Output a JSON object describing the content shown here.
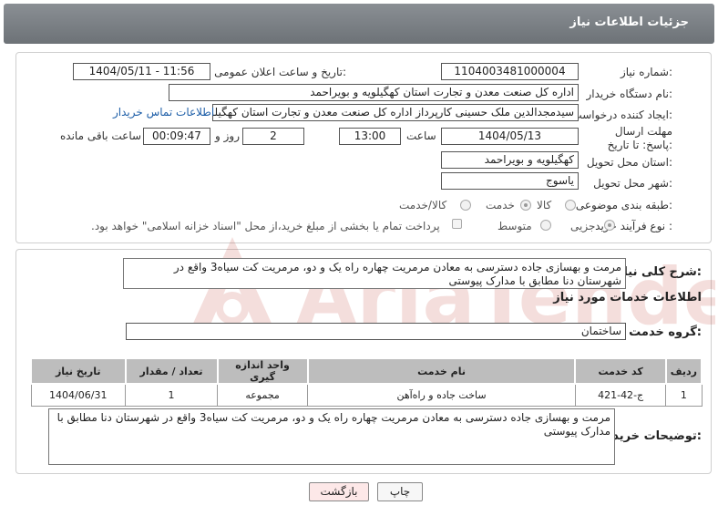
{
  "header": {
    "title": "جزئیات اطلاعات نیاز"
  },
  "form": {
    "need_number_label": "شماره نیاز:",
    "need_number": "1104003481000004",
    "announce_label": "تاریخ و ساعت اعلان عمومی:",
    "announce_value": "1404/05/11 - 11:56",
    "buyer_org_label": "نام دستگاه خریدار:",
    "buyer_org": "اداره کل صنعت  معدن و تجارت استان کهگیلویه و بویراحمد",
    "requester_label": "ایجاد کننده درخواست:",
    "requester": "سیدمجدالدین ملک حسینی کارپرداز اداره کل صنعت  معدن و تجارت استان کهگیلویه و بویراحمد",
    "contact_link": "اطلاعات تماس خریدار",
    "deadline_label": "مهلت ارسال پاسخ: تا تاریخ:",
    "deadline_date": "1404/05/13",
    "time_label": "ساعت",
    "deadline_time": "13:00",
    "days_value": "2",
    "days_label": "روز و",
    "remaining_value": "00:09:47",
    "remaining_label": "ساعت باقی مانده",
    "province_label": "استان محل تحویل:",
    "province": "کهگیلویه و بویراحمد",
    "city_label": "شهر محل تحویل:",
    "city": "یاسوج",
    "category_label": "طبقه بندی موضوعی:",
    "category_options": [
      "کالا",
      "خدمت",
      "کالا/خدمت"
    ],
    "category_selected": "خدمت",
    "process_label": "نوع فرآیند خرید :",
    "process_options": [
      "جزیی",
      "متوسط"
    ],
    "process_selected": "جزیی",
    "payment_note": "پرداخت تمام یا بخشی از مبلغ خرید،از محل \"اسناد خزانه اسلامی\" خواهد بود."
  },
  "details": {
    "summary_label": "شرح کلی نیاز:",
    "summary": "مرمت و بهسازی جاده دسترسی به معادن مرمریت چهاره راه یک و دو، مرمریت کت سیاه3 واقع در شهرستان دنا مطابق با مدارک پیوستی",
    "services_title": "اطلاعات خدمات مورد نیاز",
    "group_label": "گروه خدمت:",
    "group": "ساختمان",
    "table_headers": [
      "ردیف",
      "کد خدمت",
      "نام خدمت",
      "واحد اندازه گیری",
      "تعداد / مقدار",
      "تاریخ نیاز"
    ],
    "table_rows": [
      [
        "1",
        "ج-42-421",
        "ساخت جاده و راه‌آهن",
        "مجموعه",
        "1",
        "1404/06/31"
      ]
    ],
    "buyer_notes_label": "توضیحات خریدار:",
    "buyer_notes": "مرمت و بهسازی جاده دسترسی به معادن مرمریت چهاره راه یک و دو، مرمریت کت سیاه3 واقع در شهرستان دنا مطابق با مدارک پیوستی"
  },
  "buttons": {
    "print": "چاپ",
    "back": "بازگشت"
  },
  "watermark": {
    "text": "AriaTender.neT"
  },
  "colors": {
    "header": "#7b8085",
    "link": "#1f5fa8",
    "back_button": "#fde8e8",
    "table_header": "#bdbdbd"
  }
}
